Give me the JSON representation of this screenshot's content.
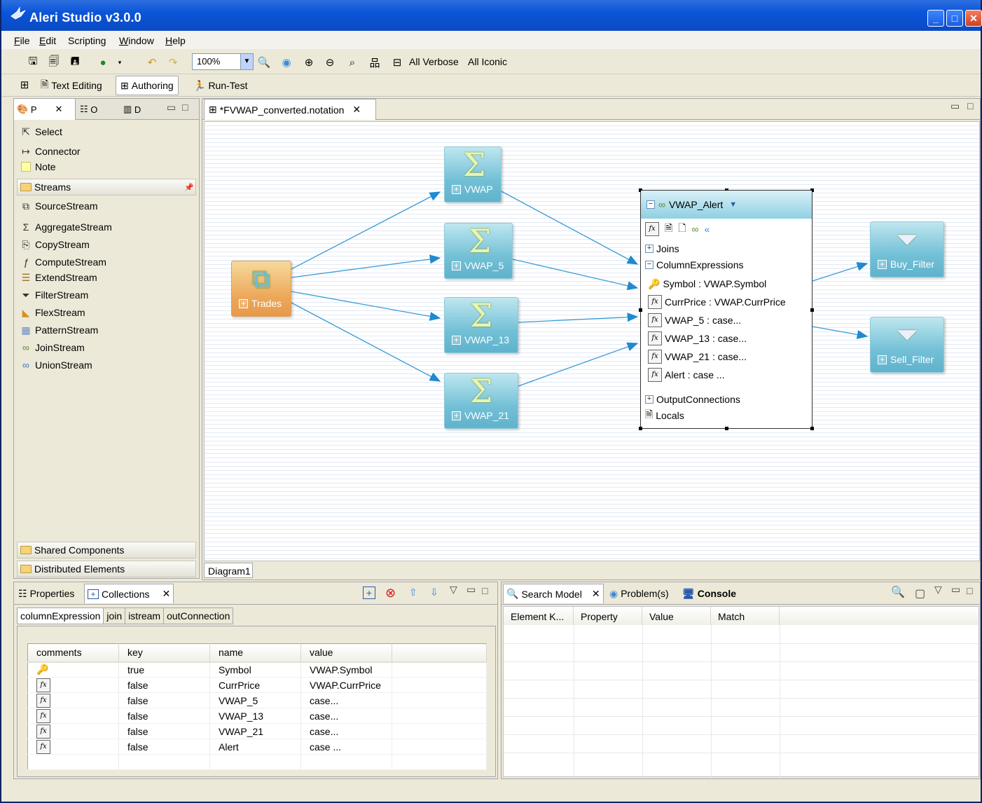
{
  "window": {
    "title": "Aleri Studio v3.0.0"
  },
  "menu": [
    {
      "label": "File",
      "u": "F",
      "rest": "ile"
    },
    {
      "label": "Edit",
      "u": "E",
      "rest": "dit"
    },
    {
      "label": "Scripting",
      "u": "",
      "rest": "Scripting"
    },
    {
      "label": "Window",
      "u": "W",
      "rest": "indow"
    },
    {
      "label": "Help",
      "u": "H",
      "rest": "elp"
    }
  ],
  "toolbar": {
    "zoom": "100%",
    "all_verbose": "All Verbose",
    "all_iconic": "All Iconic"
  },
  "perspectives": {
    "text_editing": "Text Editing",
    "authoring": "Authoring",
    "run_test": "Run-Test"
  },
  "palette": {
    "tabs": [
      "P",
      "O",
      "D"
    ],
    "tools": [
      "Select",
      "Connector",
      "Note"
    ],
    "streams_drawer": "Streams",
    "streams": [
      "SourceStream",
      "AggregateStream",
      "CopyStream",
      "ComputeStream",
      "ExtendStream",
      "FilterStream",
      "FlexStream",
      "PatternStream",
      "JoinStream",
      "UnionStream"
    ],
    "shared": "Shared Components",
    "distributed": "Distributed Elements"
  },
  "editor": {
    "tab": "*FVWAP_converted.notation",
    "diagram_tab": "Diagram1"
  },
  "diagram": {
    "nodes": {
      "trades": "Trades",
      "vwap": "VWAP",
      "vwap5": "VWAP_5",
      "vwap13": "VWAP_13",
      "vwap21": "VWAP_21",
      "buy": "Buy_Filter",
      "sell": "Sell_Filter"
    },
    "alert": {
      "title": "VWAP_Alert",
      "joins": "Joins",
      "colexpr": "ColumnExpressions",
      "exprs": [
        "Symbol : VWAP.Symbol",
        "CurrPrice : VWAP.CurrPrice",
        "VWAP_5 : case...",
        "VWAP_13 : case...",
        "VWAP_21 : case...",
        "Alert : case ..."
      ],
      "outconn": "OutputConnections",
      "locals": "Locals"
    }
  },
  "props": {
    "tabs": {
      "properties": "Properties",
      "collections": "Collections"
    },
    "subtabs": [
      "columnExpression",
      "join",
      "istream",
      "outConnection"
    ],
    "columns": [
      "comments",
      "key",
      "name",
      "value"
    ],
    "rows": [
      {
        "icon": "key-icon",
        "key": "true",
        "name": "Symbol",
        "value": "VWAP.Symbol"
      },
      {
        "icon": "fx-icon",
        "key": "false",
        "name": "CurrPrice",
        "value": "VWAP.CurrPrice"
      },
      {
        "icon": "fx-icon",
        "key": "false",
        "name": "VWAP_5",
        "value": "case..."
      },
      {
        "icon": "fx-icon",
        "key": "false",
        "name": "VWAP_13",
        "value": "case..."
      },
      {
        "icon": "fx-icon",
        "key": "false",
        "name": "VWAP_21",
        "value": "case..."
      },
      {
        "icon": "fx-icon",
        "key": "false",
        "name": "Alert",
        "value": "case ..."
      }
    ]
  },
  "search": {
    "tabs": {
      "search_model": "Search Model",
      "problems": "Problem(s)",
      "console": "Console"
    },
    "columns": [
      "Element K...",
      "Property",
      "Value",
      "Match"
    ]
  }
}
